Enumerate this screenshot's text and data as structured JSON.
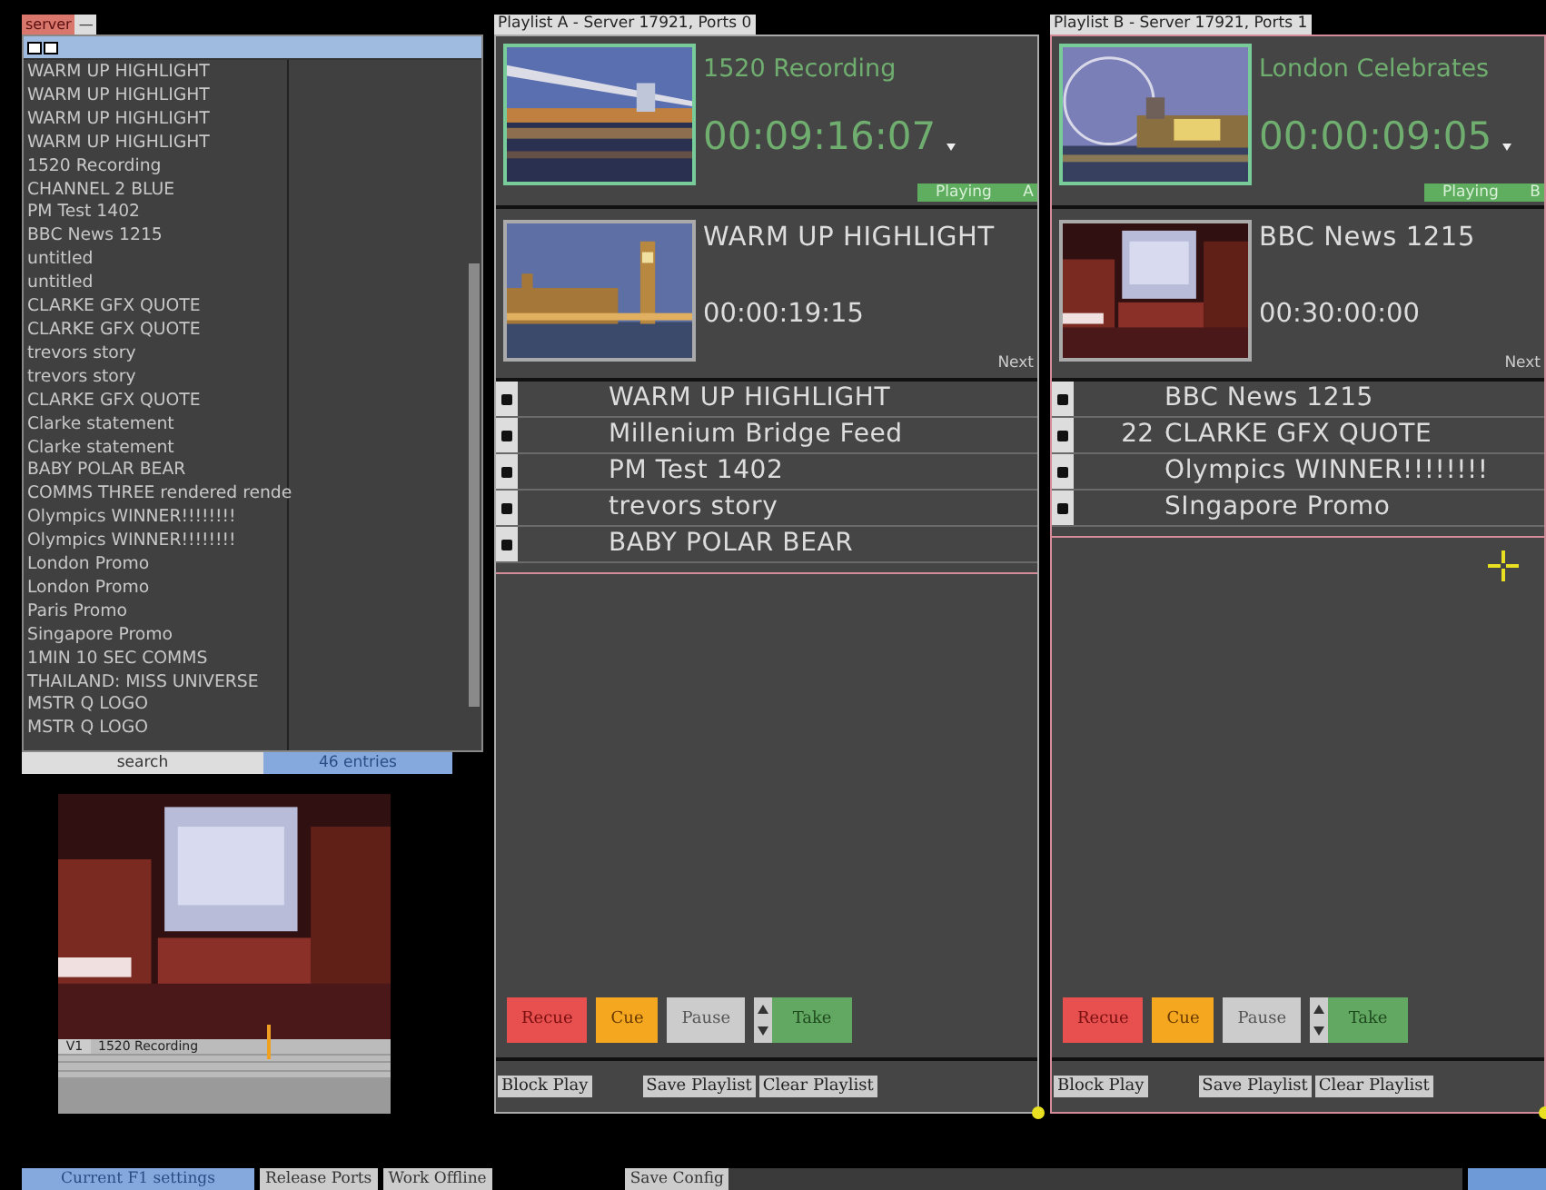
{
  "server_panel": {
    "tabs": [
      {
        "label": "server",
        "selected": true
      },
      {
        "label": "—",
        "selected": false
      }
    ],
    "items": [
      "WARM UP HIGHLIGHT",
      "WARM UP HIGHLIGHT",
      "WARM UP HIGHLIGHT",
      "WARM UP HIGHLIGHT",
      "1520 Recording",
      "CHANNEL 2 BLUE",
      "PM Test 1402",
      "BBC News 1215",
      "untitled",
      "untitled",
      "CLARKE GFX QUOTE",
      "CLARKE GFX QUOTE",
      "trevors story",
      "trevors story",
      "CLARKE GFX QUOTE",
      "Clarke statement",
      "Clarke statement",
      "BABY POLAR BEAR",
      "COMMS THREE rendered rende",
      "Olympics WINNER!!!!!!!!",
      "Olympics WINNER!!!!!!!!",
      "London Promo",
      "London Promo",
      "Paris Promo",
      "Singapore Promo",
      "1MIN 10 SEC COMMS",
      "THAILAND: MISS UNIVERSE",
      "MSTR Q LOGO",
      "MSTR Q LOGO"
    ],
    "search_label": "search",
    "entry_count": "46 entries"
  },
  "preview": {
    "kind": "picture",
    "track_label": "V1",
    "clip": "1520 Recording"
  },
  "playlists": [
    {
      "title": "Playlist A - Server 17921, Ports 0",
      "selected": false,
      "current": {
        "title": "1520 Recording",
        "timecode": "00:09:16:07",
        "status": "Playing",
        "port": "A"
      },
      "next": {
        "title": "WARM UP HIGHLIGHT",
        "timecode": "00:00:19:15",
        "label": "Next"
      },
      "items": [
        {
          "title": "WARM UP HIGHLIGHT"
        },
        {
          "title": "Millenium Bridge Feed"
        },
        {
          "title": "PM Test 1402"
        },
        {
          "title": "trevors story"
        },
        {
          "title": "BABY POLAR BEAR"
        }
      ],
      "controls": [
        {
          "label": "Recue",
          "kind": "recue"
        },
        {
          "label": "Cue",
          "kind": "cue"
        },
        {
          "label": "Pause",
          "kind": "pause"
        },
        {
          "label": "Take",
          "kind": "take"
        }
      ],
      "footer": [
        "Block Play",
        "Save Playlist",
        "Clear Playlist"
      ]
    },
    {
      "title": "Playlist B - Server 17921, Ports 1",
      "selected": true,
      "current": {
        "title": "London Celebrates",
        "timecode": "00:00:09:05",
        "status": "Playing",
        "port": "B"
      },
      "next": {
        "title": "BBC News 1215",
        "timecode": "00:30:00:00",
        "label": "Next"
      },
      "items": [
        {
          "title": "BBC News 1215"
        },
        {
          "number": "22",
          "title": "CLARKE GFX QUOTE"
        },
        {
          "title": "Olympics WINNER!!!!!!!!"
        },
        {
          "title": "SIngapore Promo"
        }
      ],
      "controls": [
        {
          "label": "Recue",
          "kind": "recue"
        },
        {
          "label": "Cue",
          "kind": "cue"
        },
        {
          "label": "Pause",
          "kind": "pause"
        },
        {
          "label": "Take",
          "kind": "take"
        }
      ],
      "footer": [
        "Block Play",
        "Save Playlist",
        "Clear Playlist"
      ]
    }
  ],
  "status_bar": [
    {
      "label": "Current F1 settings",
      "kind": "highlight"
    },
    {
      "label": "Release Ports",
      "kind": "button"
    },
    {
      "label": "Work Offline",
      "kind": "button"
    },
    {
      "label": "Save Config",
      "kind": "button"
    }
  ]
}
